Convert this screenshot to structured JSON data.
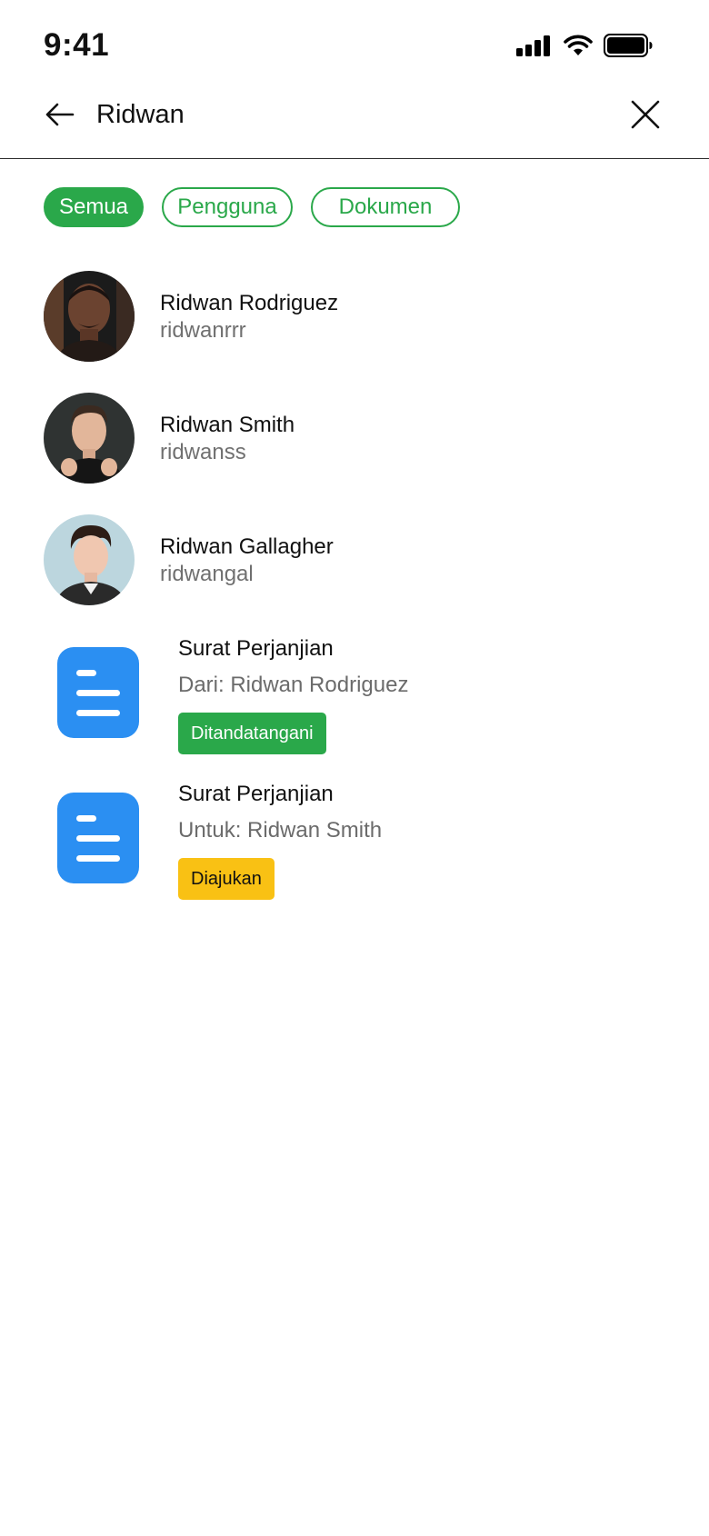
{
  "status_bar": {
    "time": "9:41",
    "icons": [
      "signal-icon",
      "wifi-icon",
      "battery-icon"
    ]
  },
  "search": {
    "query": "Ridwan",
    "back_icon": "arrow-left-icon",
    "clear_icon": "close-icon"
  },
  "filters": [
    {
      "label": "Semua",
      "active": true
    },
    {
      "label": "Pengguna",
      "active": false
    },
    {
      "label": "Dokumen",
      "active": false
    }
  ],
  "users": [
    {
      "name": "Ridwan Rodriguez",
      "handle": "ridwanrrr"
    },
    {
      "name": "Ridwan Smith",
      "handle": "ridwanss"
    },
    {
      "name": "Ridwan Gallagher",
      "handle": "ridwangal"
    }
  ],
  "documents": [
    {
      "title": "Surat Perjanjian",
      "subtitle": "Dari: Ridwan Rodriguez",
      "status": "Ditandatangani",
      "status_color": "#2aa84a",
      "icon": "document-icon"
    },
    {
      "title": "Surat Perjanjian",
      "subtitle": "Untuk: Ridwan Smith",
      "status": "Diajukan",
      "status_color": "#f9c114",
      "icon": "document-icon"
    }
  ],
  "colors": {
    "accent": "#2aa84a",
    "doc_icon": "#2b8ff2",
    "pending": "#f9c114",
    "muted_text": "#707070"
  }
}
